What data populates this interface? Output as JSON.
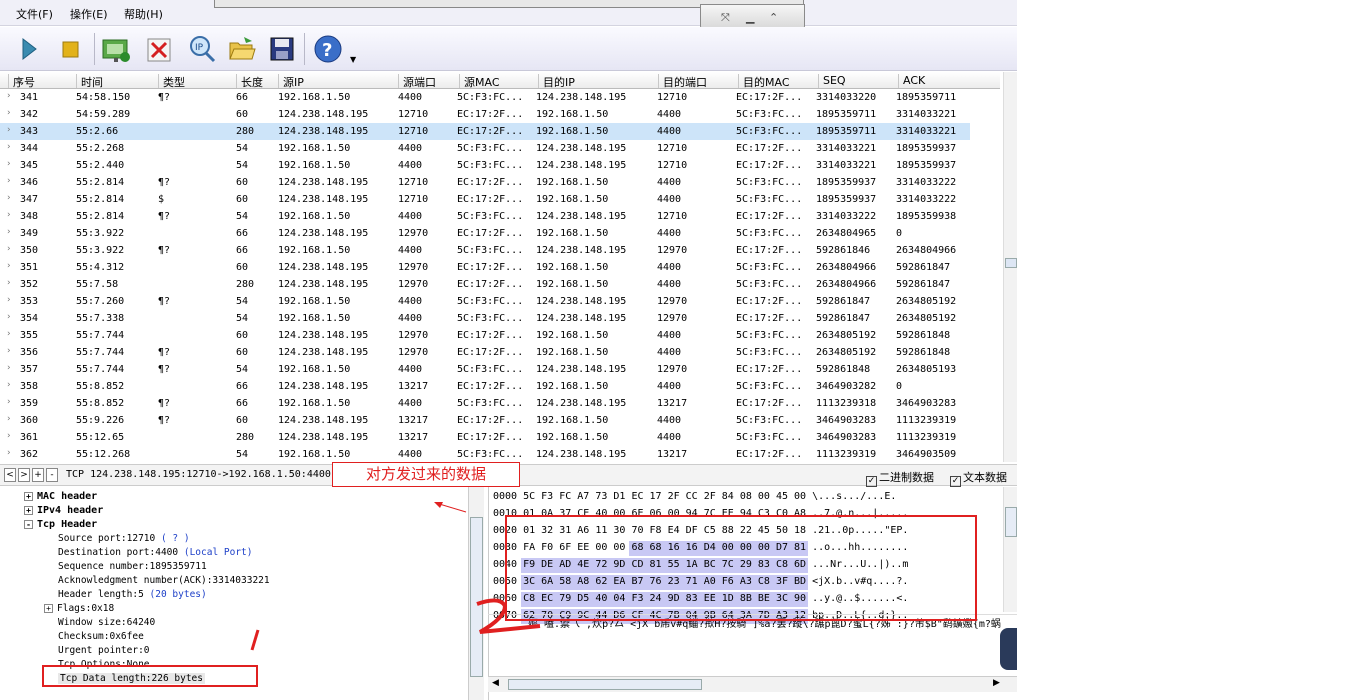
{
  "menu": {
    "file": "文件(F)",
    "operate": "操作(E)",
    "help": "帮助(H)"
  },
  "toolbar": {
    "icons": [
      "play-icon",
      "stop-icon",
      "capture-config-icon",
      "clear-icon",
      "ip-search-icon",
      "open-folder-icon",
      "save-icon",
      "help-icon"
    ]
  },
  "columns": [
    "序号",
    "时间",
    "类型",
    "长度",
    "源IP",
    "源端口",
    "源MAC",
    "目的IP",
    "目的端口",
    "目的MAC",
    "SEQ",
    "ACK"
  ],
  "rows": [
    [
      "341",
      "54:58.150",
      "¶?",
      "66",
      "192.168.1.50",
      "4400",
      "5C:F3:FC...",
      "124.238.148.195",
      "12710",
      "EC:17:2F...",
      "3314033220",
      "1895359711"
    ],
    [
      "342",
      "54:59.289",
      "",
      "60",
      "124.238.148.195",
      "12710",
      "EC:17:2F...",
      "192.168.1.50",
      "4400",
      "5C:F3:FC...",
      "1895359711",
      "3314033221"
    ],
    [
      "343",
      "55:2.66",
      "",
      "280",
      "124.238.148.195",
      "12710",
      "EC:17:2F...",
      "192.168.1.50",
      "4400",
      "5C:F3:FC...",
      "1895359711",
      "3314033221"
    ],
    [
      "344",
      "55:2.268",
      "",
      "54",
      "192.168.1.50",
      "4400",
      "5C:F3:FC...",
      "124.238.148.195",
      "12710",
      "EC:17:2F...",
      "3314033221",
      "1895359937"
    ],
    [
      "345",
      "55:2.440",
      "",
      "54",
      "192.168.1.50",
      "4400",
      "5C:F3:FC...",
      "124.238.148.195",
      "12710",
      "EC:17:2F...",
      "3314033221",
      "1895359937"
    ],
    [
      "346",
      "55:2.814",
      "¶?",
      "60",
      "124.238.148.195",
      "12710",
      "EC:17:2F...",
      "192.168.1.50",
      "4400",
      "5C:F3:FC...",
      "1895359937",
      "3314033222"
    ],
    [
      "347",
      "55:2.814",
      "$",
      "60",
      "124.238.148.195",
      "12710",
      "EC:17:2F...",
      "192.168.1.50",
      "4400",
      "5C:F3:FC...",
      "1895359937",
      "3314033222"
    ],
    [
      "348",
      "55:2.814",
      "¶?",
      "54",
      "192.168.1.50",
      "4400",
      "5C:F3:FC...",
      "124.238.148.195",
      "12710",
      "EC:17:2F...",
      "3314033222",
      "1895359938"
    ],
    [
      "349",
      "55:3.922",
      "",
      "66",
      "124.238.148.195",
      "12970",
      "EC:17:2F...",
      "192.168.1.50",
      "4400",
      "5C:F3:FC...",
      "2634804965",
      "0"
    ],
    [
      "350",
      "55:3.922",
      "¶?",
      "66",
      "192.168.1.50",
      "4400",
      "5C:F3:FC...",
      "124.238.148.195",
      "12970",
      "EC:17:2F...",
      "592861846",
      "2634804966"
    ],
    [
      "351",
      "55:4.312",
      "",
      "60",
      "124.238.148.195",
      "12970",
      "EC:17:2F...",
      "192.168.1.50",
      "4400",
      "5C:F3:FC...",
      "2634804966",
      "592861847"
    ],
    [
      "352",
      "55:7.58",
      "",
      "280",
      "124.238.148.195",
      "12970",
      "EC:17:2F...",
      "192.168.1.50",
      "4400",
      "5C:F3:FC...",
      "2634804966",
      "592861847"
    ],
    [
      "353",
      "55:7.260",
      "¶?",
      "54",
      "192.168.1.50",
      "4400",
      "5C:F3:FC...",
      "124.238.148.195",
      "12970",
      "EC:17:2F...",
      "592861847",
      "2634805192"
    ],
    [
      "354",
      "55:7.338",
      "",
      "54",
      "192.168.1.50",
      "4400",
      "5C:F3:FC...",
      "124.238.148.195",
      "12970",
      "EC:17:2F...",
      "592861847",
      "2634805192"
    ],
    [
      "355",
      "55:7.744",
      "",
      "60",
      "124.238.148.195",
      "12970",
      "EC:17:2F...",
      "192.168.1.50",
      "4400",
      "5C:F3:FC...",
      "2634805192",
      "592861848"
    ],
    [
      "356",
      "55:7.744",
      "¶?",
      "60",
      "124.238.148.195",
      "12970",
      "EC:17:2F...",
      "192.168.1.50",
      "4400",
      "5C:F3:FC...",
      "2634805192",
      "592861848"
    ],
    [
      "357",
      "55:7.744",
      "¶?",
      "54",
      "192.168.1.50",
      "4400",
      "5C:F3:FC...",
      "124.238.148.195",
      "12970",
      "EC:17:2F...",
      "592861848",
      "2634805193"
    ],
    [
      "358",
      "55:8.852",
      "",
      "66",
      "124.238.148.195",
      "13217",
      "EC:17:2F...",
      "192.168.1.50",
      "4400",
      "5C:F3:FC...",
      "3464903282",
      "0"
    ],
    [
      "359",
      "55:8.852",
      "¶?",
      "66",
      "192.168.1.50",
      "4400",
      "5C:F3:FC...",
      "124.238.148.195",
      "13217",
      "EC:17:2F...",
      "1113239318",
      "3464903283"
    ],
    [
      "360",
      "55:9.226",
      "¶?",
      "60",
      "124.238.148.195",
      "13217",
      "EC:17:2F...",
      "192.168.1.50",
      "4400",
      "5C:F3:FC...",
      "3464903283",
      "1113239319"
    ],
    [
      "361",
      "55:12.65",
      "",
      "280",
      "124.238.148.195",
      "13217",
      "EC:17:2F...",
      "192.168.1.50",
      "4400",
      "5C:F3:FC...",
      "3464903283",
      "1113239319"
    ],
    [
      "362",
      "55:12.268",
      "",
      "54",
      "192.168.1.50",
      "4400",
      "5C:F3:FC...",
      "124.238.148.195",
      "13217",
      "EC:17:2F...",
      "1113239319",
      "3464903509"
    ]
  ],
  "selected_row": "343",
  "nav": {
    "prev": "<",
    "next": ">",
    "plus": "+",
    "minus": "-"
  },
  "summary": "TCP 124.238.148.195:12710->192.168.1.50:4400",
  "annotation": "对方发过来的数据",
  "checks": {
    "binary": "二进制数据",
    "text": "文本数据",
    "mark": "✓"
  },
  "tree": {
    "mac": "MAC header",
    "ipv4": "IPv4 header",
    "tcp": "Tcp Header",
    "src_port": "Source port:12710",
    "src_port_note": "( ? )",
    "dst_port": "Destination port:4400",
    "dst_port_note": "(Local Port)",
    "seq": "Sequence number:1895359711",
    "ack": "Acknowledgment number(ACK):3314033221",
    "hlen": "Header length:5",
    "hlen_note": "(20 bytes)",
    "flags": "Flags:0x18",
    "window": "Window size:64240",
    "checksum": "Checksum:0x6fee",
    "urgent": "Urgent pointer:0",
    "options": "Tcp Options:None",
    "datalen": "Tcp Data length:226 bytes",
    "exp_plus": "+",
    "exp_minus": "-"
  },
  "hex": [
    "0000 5C F3 FC A7 73 D1 EC 17 2F CC 2F 84 08 00 45 00 \\...s.../...E.",
    "0010 01 0A 37 CE 40 00 6E 06 00 94 7C EE 94 C3 C0 A8 ..7.@.n...|.....",
    "0020 01 32 31 A6 11 30 70 F8 E4 DF C5 88 22 45 50 18 .21..0p.....\"EP.",
    "0030 FA F0 6F EE 00 00 68 68 16 16 D4 00 00 00 D7 81 ..o...hh........",
    "0040 F9 DE AD 4E 72 9D CD 81 55 1A BC 7C 29 83 C8 6D ...Nr...U..|)..m",
    "0050 3C 6A 58 A8 62 EA B7 76 23 71 A0 F6 A3 C8 3F BD <jX.b..v#q....?.",
    "0060 C8 EC 79 D5 40 04 F3 24 9D 83 EE 1D 8B BE 3C 90 ..y.@..$......<.",
    "0070 62 70 C9 9C 44 D6 CF 4C 7B 04 9B 64 3A 7D A3 12 bp..D..L{..d:}.."
  ],
  "textline": "嫗 嗑.禦乁 ,炊p?厶 <jX b乕v#q鲻?揿H?按騎 ]%a?罢?蹝\\?蹍p蓖D?蜜L{?姊 :}?芾$B\"鹞鑛嫐{m?蜗",
  "colors": {
    "selected": "#cde4f9",
    "highlight": "#c8c8f4",
    "annotation": "#e02020",
    "blue_text": "#1e40c8"
  }
}
